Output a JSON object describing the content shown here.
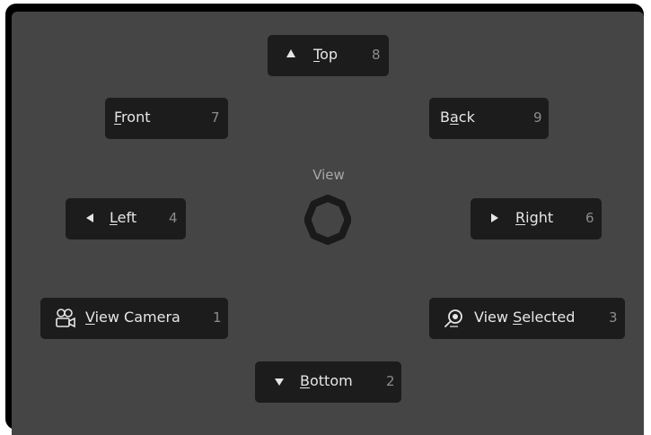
{
  "pie_menu": {
    "title": "View",
    "items": {
      "top": {
        "label_first": "T",
        "label_rest": "op",
        "key": "8",
        "icon": "triangle-up-icon"
      },
      "front": {
        "label_first": "F",
        "label_rest": "ront",
        "key": "7"
      },
      "back": {
        "label_pre": "B",
        "label_first": "a",
        "label_rest": "ck",
        "key": "9"
      },
      "left": {
        "label_first": "L",
        "label_rest": "eft",
        "key": "4",
        "icon": "triangle-left-icon"
      },
      "right": {
        "label_first": "R",
        "label_rest": "ight",
        "key": "6",
        "icon": "triangle-right-icon"
      },
      "view_camera": {
        "label_first": "V",
        "label_rest": "iew Camera",
        "key": "1",
        "icon": "camera-icon"
      },
      "view_selected": {
        "label_pre": "View ",
        "label_first": "S",
        "label_rest": "elected",
        "key": "3",
        "icon": "zoom-selected-icon"
      },
      "bottom": {
        "label_first": "B",
        "label_rest": "ottom",
        "key": "2",
        "icon": "triangle-down-icon"
      }
    }
  }
}
